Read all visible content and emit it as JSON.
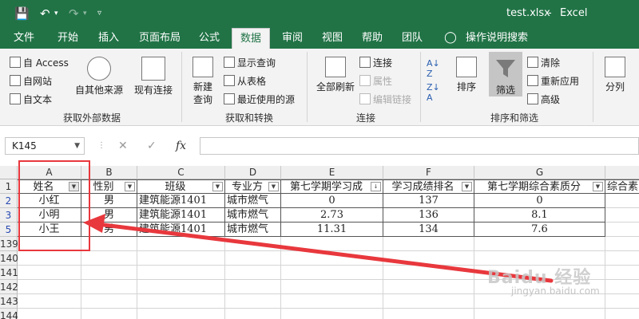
{
  "window": {
    "filename": "test.xlsx",
    "app": "Excel",
    "accent": "#217346"
  },
  "tabs": [
    {
      "label": "文件"
    },
    {
      "label": "开始"
    },
    {
      "label": "插入"
    },
    {
      "label": "页面布局"
    },
    {
      "label": "公式"
    },
    {
      "label": "数据",
      "active": true
    },
    {
      "label": "审阅"
    },
    {
      "label": "视图"
    },
    {
      "label": "帮助"
    },
    {
      "label": "团队"
    },
    {
      "label": "操作说明搜索"
    }
  ],
  "ribbon": {
    "external": {
      "access": "自 Access",
      "web": "自网站",
      "text": "自文本",
      "other": "自其他来源",
      "existing": "现有连接",
      "group": "获取外部数据"
    },
    "transform": {
      "new_query": "新建",
      "new_query2": "查询",
      "show_queries": "显示查询",
      "from_table": "从表格",
      "recent": "最近使用的源",
      "group": "获取和转换"
    },
    "connections": {
      "refresh": "全部刷新",
      "connections": "连接",
      "properties": "属性",
      "edit_links": "编辑链接",
      "group": "连接"
    },
    "sort": {
      "sort": "排序",
      "filter": "筛选",
      "clear": "清除",
      "reapply": "重新应用",
      "advanced": "高级",
      "group": "排序和筛选"
    },
    "tools": {
      "split": "分列"
    }
  },
  "formula_bar": {
    "name_box": "K145",
    "fx": "fx"
  },
  "sheet": {
    "columns": [
      "A",
      "B",
      "C",
      "D",
      "E",
      "F",
      "G"
    ],
    "headers": [
      "姓名",
      "性别",
      "班级",
      "专业方",
      "第七学期学习成",
      "学习成绩排名",
      "第七学期综合素质分",
      "综合素"
    ],
    "rows": [
      {
        "row": "2",
        "cells": [
          "小红",
          "男",
          "建筑能源1401",
          "城市燃气",
          "0",
          "137",
          "0"
        ]
      },
      {
        "row": "3",
        "cells": [
          "小明",
          "男",
          "建筑能源1401",
          "城市燃气",
          "2.73",
          "136",
          "8.1"
        ]
      },
      {
        "row": "5",
        "cells": [
          "小王",
          "男",
          "建筑能源1401",
          "城市燃气",
          "11.31",
          "134",
          "7.6"
        ]
      }
    ],
    "header_row": "1",
    "empty_rows": [
      "139",
      "140",
      "141",
      "142",
      "143",
      "144"
    ]
  },
  "watermark": {
    "main": "Baidu 经验",
    "sub": "jingyan.baidu.com"
  }
}
